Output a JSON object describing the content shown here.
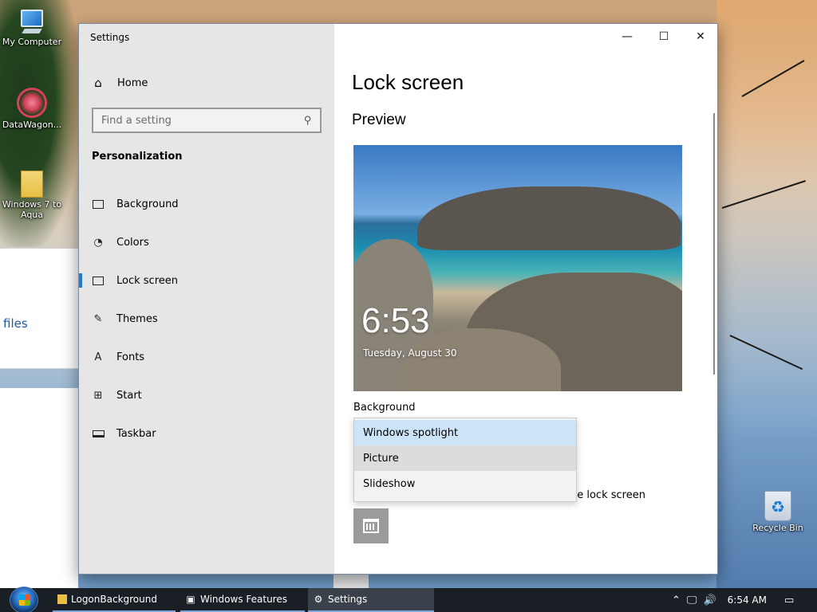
{
  "desktop": {
    "icons": [
      {
        "label": "My Computer",
        "icon": "computer-icon"
      },
      {
        "label": "DataWagon...",
        "icon": "datawagon-icon"
      },
      {
        "label": "Windows 7 to Aqua",
        "icon": "folder-icon"
      },
      {
        "label": "Recycle Bin",
        "icon": "recycle-bin-icon"
      }
    ],
    "background_window_text": "files"
  },
  "window": {
    "title": "Settings",
    "controls": {
      "minimize": "—",
      "maximize": "☐",
      "close": "✕"
    }
  },
  "nav": {
    "home": "Home",
    "search_placeholder": "Find a setting",
    "section": "Personalization",
    "items": [
      {
        "label": "Background",
        "icon": "picture-icon"
      },
      {
        "label": "Colors",
        "icon": "palette-icon"
      },
      {
        "label": "Lock screen",
        "icon": "lock-screen-icon",
        "active": true
      },
      {
        "label": "Themes",
        "icon": "themes-icon"
      },
      {
        "label": "Fonts",
        "icon": "fonts-icon"
      },
      {
        "label": "Start",
        "icon": "start-icon"
      },
      {
        "label": "Taskbar",
        "icon": "taskbar-icon"
      }
    ]
  },
  "content": {
    "title": "Lock screen",
    "preview_heading": "Preview",
    "preview_time": "6:53",
    "preview_date": "Tuesday, August 30",
    "background_label": "Background",
    "background_options": [
      "Windows spotlight",
      "Picture",
      "Slideshow"
    ],
    "selected_option": "Windows spotlight",
    "hovered_option": "Picture",
    "partial_text": "he lock screen"
  },
  "taskbar": {
    "items": [
      {
        "label": "LogonBackground",
        "icon": "folder-icon"
      },
      {
        "label": "Windows Features",
        "icon": "windows-features-icon"
      },
      {
        "label": "Settings",
        "icon": "gear-icon",
        "active": true
      }
    ],
    "clock": "6:54 AM",
    "accent": "#7aa5d6"
  }
}
